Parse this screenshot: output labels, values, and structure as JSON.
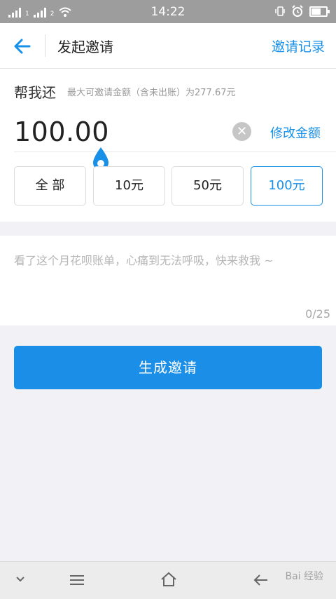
{
  "status_bar": {
    "time": "14:22",
    "sim1_label": "1",
    "sim2_label": "2"
  },
  "nav": {
    "title": "发起邀请",
    "right_link": "邀请记录"
  },
  "amount_section": {
    "title": "帮我还",
    "limit_text": "最大可邀请金额（含未出账）为277.67元",
    "value": "100.00",
    "edit_link": "修改金额"
  },
  "presets": [
    {
      "label": "全 部",
      "selected": false
    },
    {
      "label": "10元",
      "selected": false
    },
    {
      "label": "50元",
      "selected": false
    },
    {
      "label": "100元",
      "selected": true
    }
  ],
  "message": {
    "placeholder": "看了这个月花呗账单，心痛到无法呼吸，快来救我 ~",
    "counter": "0/25"
  },
  "submit": {
    "label": "生成邀请"
  },
  "watermark": {
    "text": "Bai 经验"
  },
  "colors": {
    "accent": "#1890e8",
    "button": "#1b8fe8",
    "background": "#f2f2f6"
  }
}
